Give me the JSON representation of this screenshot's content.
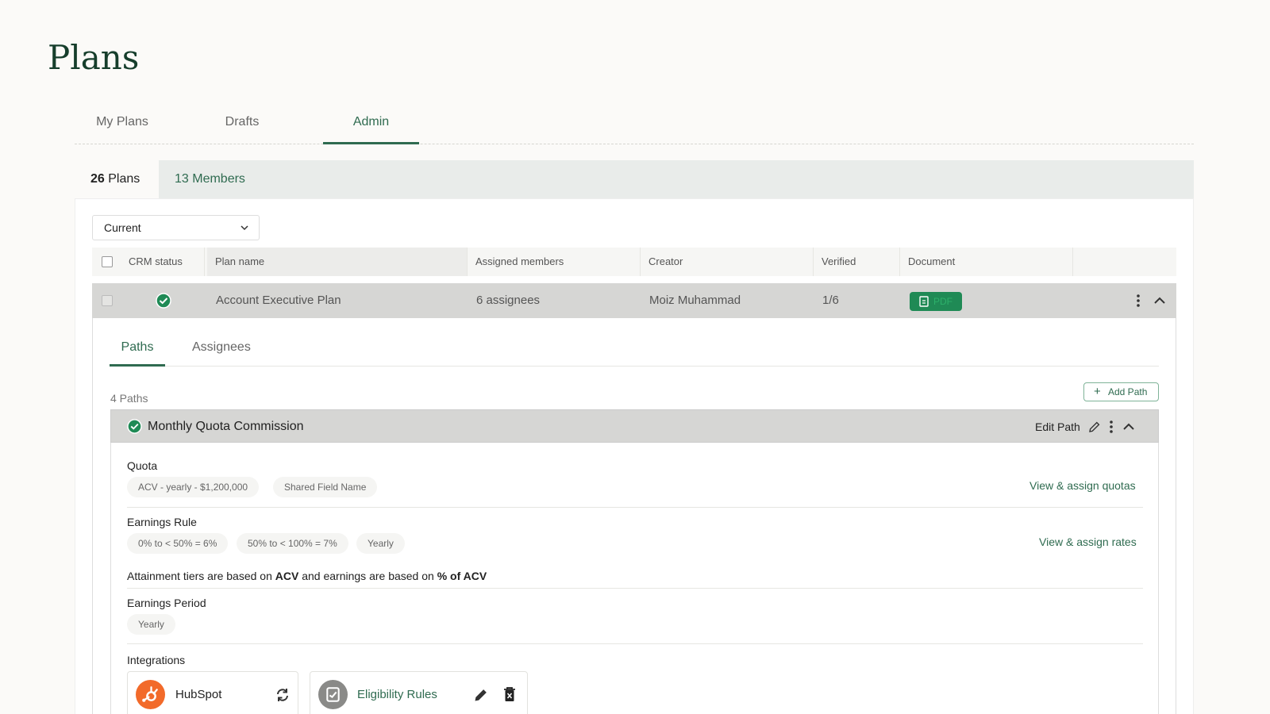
{
  "page": {
    "title": "Plans"
  },
  "top_tabs": [
    {
      "label": "My Plans",
      "active": false
    },
    {
      "label": "Drafts",
      "active": false
    },
    {
      "label": "Admin",
      "active": true
    }
  ],
  "sub_tabs": {
    "plans": {
      "count": "26",
      "label": " Plans"
    },
    "members": {
      "count": "13",
      "label": " Members"
    }
  },
  "filter": {
    "selected": "Current"
  },
  "table": {
    "headers": [
      "CRM status",
      "Plan name",
      "Assigned members",
      "Creator",
      "Verified",
      "Document"
    ],
    "row": {
      "plan_name": "Account Executive Plan",
      "assigned": "6 assignees",
      "creator": "Moiz Muhammad",
      "verified": "1/6",
      "document": "PDF"
    }
  },
  "detail": {
    "tabs": [
      {
        "label": "Paths",
        "active": true
      },
      {
        "label": "Assignees",
        "active": false
      }
    ],
    "paths_count": "4 Paths",
    "add_path_label": "Add Path",
    "path": {
      "title": "Monthly Quota Commission",
      "edit_label": "Edit Path",
      "quota": {
        "label": "Quota",
        "chips": [
          "ACV - yearly - $1,200,000",
          "Shared Field Name"
        ],
        "link": "View & assign quotas"
      },
      "earnings_rule": {
        "label": "Earnings Rule",
        "chips": [
          "0% to < 50% = 6%",
          "50% to < 100% = 7%",
          "Yearly"
        ],
        "link": "View & assign rates"
      },
      "note": {
        "prefix": "Attainment tiers are based on ",
        "b1": "ACV",
        "middle": " and earnings are based on ",
        "b2": "% of ACV"
      },
      "earnings_period": {
        "label": "Earnings Period",
        "chips": [
          "Yearly"
        ]
      },
      "integrations": {
        "label": "Integrations",
        "hubspot": "HubSpot",
        "eligibility": "Eligibility Rules"
      }
    }
  },
  "colors": {
    "accent": "#2f6b50",
    "title": "#163e2c",
    "pdf_badge": "#1f8a55",
    "hubspot": "#f26a2a"
  }
}
